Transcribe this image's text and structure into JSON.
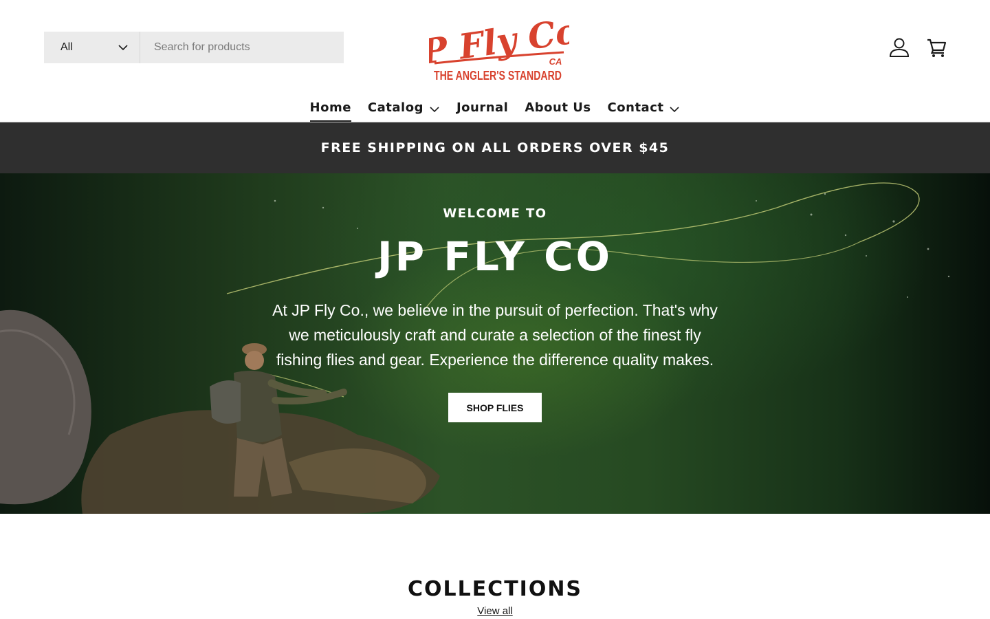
{
  "search": {
    "category_label": "All",
    "placeholder": "Search for products"
  },
  "brand": {
    "script": "JP Fly Co.",
    "country": "CA",
    "tagline": "THE ANGLER'S STANDARD",
    "logo_color": "#d8422e"
  },
  "nav": {
    "items": [
      {
        "label": "Home"
      },
      {
        "label": "Catalog"
      },
      {
        "label": "Journal"
      },
      {
        "label": "About Us"
      },
      {
        "label": "Contact"
      }
    ]
  },
  "icons": {
    "account": "account-icon",
    "cart": "cart-icon"
  },
  "announcement": {
    "text": "FREE SHIPPING ON ALL ORDERS OVER $45"
  },
  "hero": {
    "eyebrow": "WELCOME TO",
    "title": "JP FLY CO",
    "text": "At JP Fly Co., we believe in the pursuit of perfection. That's why we meticulously craft and curate a selection of the finest fly fishing flies and gear. Experience the difference quality makes.",
    "button_label": "SHOP FLIES"
  },
  "collections": {
    "title": "COLLECTIONS",
    "link_label": "View all"
  }
}
